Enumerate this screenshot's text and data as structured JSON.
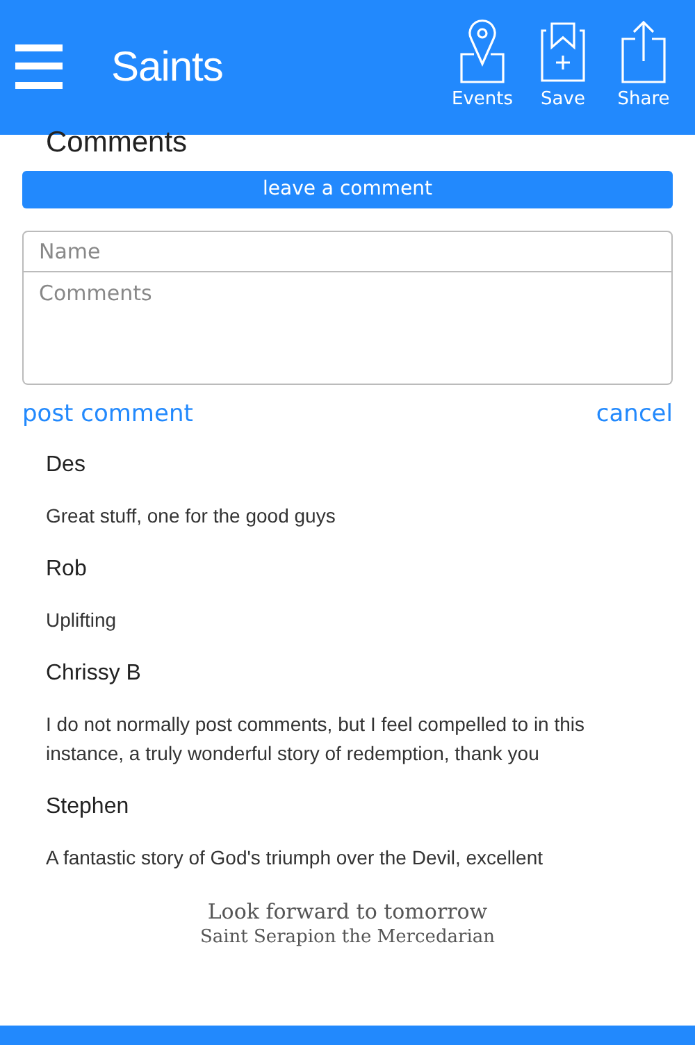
{
  "header": {
    "title": "Saints",
    "actions": [
      {
        "kind": "events",
        "label": "Events"
      },
      {
        "kind": "save",
        "label": "Save"
      },
      {
        "kind": "share",
        "label": "Share"
      }
    ]
  },
  "section_title": "Comments",
  "leave_comment_button": "leave a comment",
  "form": {
    "name_placeholder": "Name",
    "comments_placeholder": "Comments",
    "post_link": "post comment",
    "cancel_link": "cancel"
  },
  "comments": [
    {
      "author": "Des",
      "text": "Great stuff, one for the good guys"
    },
    {
      "author": "Rob",
      "text": "Uplifting"
    },
    {
      "author": "Chrissy B",
      "text": "I do not normally post comments, but I feel compelled to in this instance, a truly wonderful story of redemption, thank you"
    },
    {
      "author": "Stephen",
      "text": "A fantastic story of God's triumph over the Devil, excellent"
    }
  ],
  "footer_quote": {
    "line": "Look forward to tomorrow",
    "saint": "Saint Serapion the Mercedarian"
  }
}
